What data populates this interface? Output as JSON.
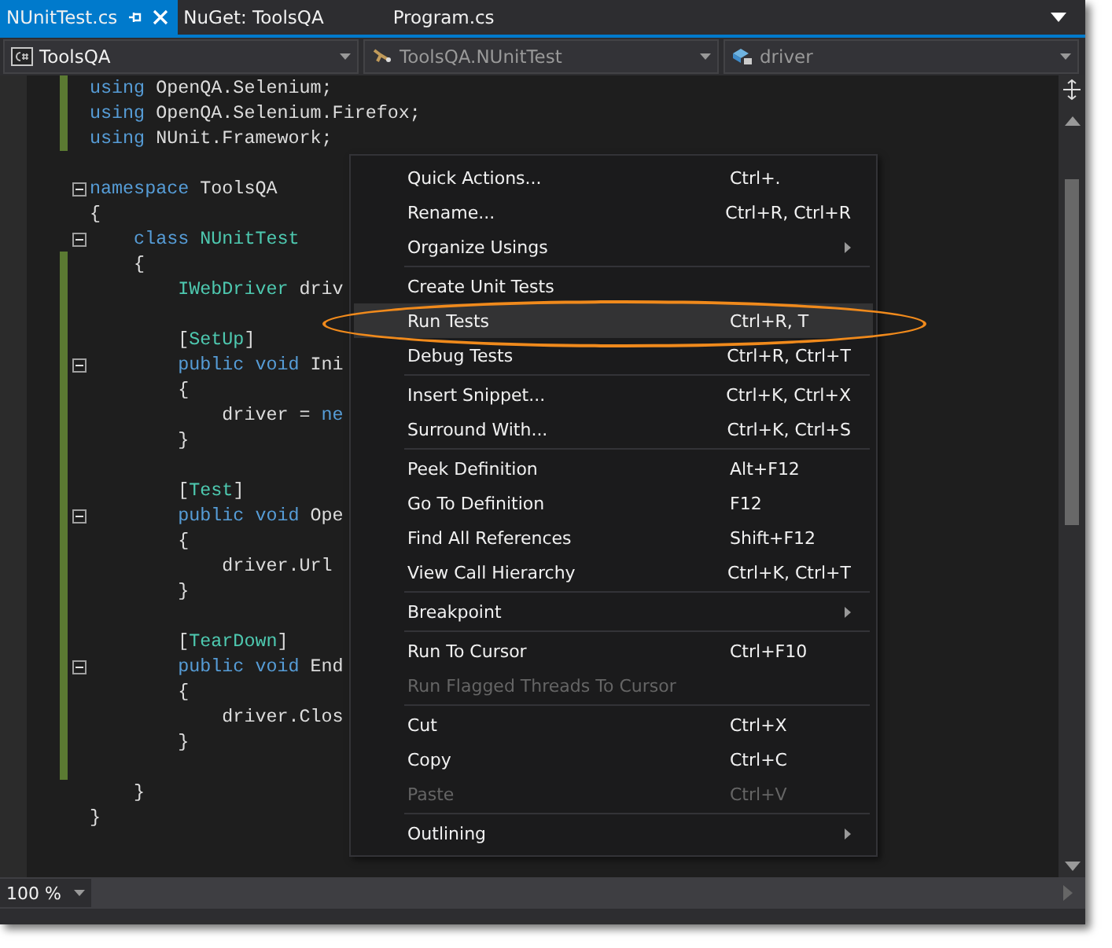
{
  "tabs": [
    {
      "label": "NUnitTest.cs",
      "selected": true,
      "pinned": true,
      "closable": true
    },
    {
      "label": "NuGet: ToolsQA",
      "selected": false,
      "pinned": false,
      "closable": false
    },
    {
      "label": "Program.cs",
      "selected": false,
      "pinned": false,
      "closable": false
    }
  ],
  "navigation": [
    {
      "text": "ToolsQA",
      "kind": "project",
      "dimmed": false
    },
    {
      "text": "ToolsQA.NUnitTest",
      "kind": "class",
      "dimmed": true
    },
    {
      "text": "driver",
      "kind": "field",
      "dimmed": true
    }
  ],
  "code_lines": [
    {
      "kind": "code",
      "fold": false,
      "changed": true,
      "tokens": [
        {
          "text": "using",
          "kind": "keyword"
        },
        {
          "text": " OpenQA.Selenium;",
          "kind": "plain"
        }
      ]
    },
    {
      "kind": "code",
      "fold": false,
      "changed": true,
      "tokens": [
        {
          "text": "using",
          "kind": "keyword"
        },
        {
          "text": " OpenQA.Selenium.Firefox;",
          "kind": "plain"
        }
      ]
    },
    {
      "kind": "code",
      "fold": false,
      "changed": true,
      "tokens": [
        {
          "text": "using",
          "kind": "keyword"
        },
        {
          "text": " NUnit.Framework;",
          "kind": "plain"
        }
      ]
    },
    {
      "kind": "blank"
    },
    {
      "kind": "code",
      "fold": true,
      "changed": false,
      "tokens": [
        {
          "text": "namespace",
          "kind": "keyword"
        },
        {
          "text": " ToolsQA",
          "kind": "plain"
        }
      ]
    },
    {
      "kind": "code",
      "fold": false,
      "changed": false,
      "tokens": [
        {
          "text": "{",
          "kind": "plain"
        }
      ]
    },
    {
      "kind": "code",
      "fold": true,
      "changed": false,
      "tokens": [
        {
          "text": "    class",
          "kind": "keyword"
        },
        {
          "text": " NUnitTest",
          "kind": "type"
        }
      ]
    },
    {
      "kind": "code",
      "fold": false,
      "changed": true,
      "tokens": [
        {
          "text": "    {",
          "kind": "plain"
        }
      ]
    },
    {
      "kind": "code",
      "fold": false,
      "changed": true,
      "tokens": [
        {
          "text": "        IWebDriver",
          "kind": "type"
        },
        {
          "text": " driv",
          "kind": "plain"
        }
      ]
    },
    {
      "kind": "blank",
      "changed": true
    },
    {
      "kind": "code",
      "fold": false,
      "changed": true,
      "tokens": [
        {
          "text": "        [",
          "kind": "plain"
        },
        {
          "text": "SetUp",
          "kind": "type"
        },
        {
          "text": "]",
          "kind": "plain"
        }
      ]
    },
    {
      "kind": "code",
      "fold": true,
      "changed": true,
      "tokens": [
        {
          "text": "        public void",
          "kind": "keyword"
        },
        {
          "text": " Ini",
          "kind": "plain"
        }
      ]
    },
    {
      "kind": "code",
      "fold": false,
      "changed": true,
      "tokens": [
        {
          "text": "        {",
          "kind": "plain"
        }
      ]
    },
    {
      "kind": "code",
      "fold": false,
      "changed": true,
      "tokens": [
        {
          "text": "            driver = ",
          "kind": "plain"
        },
        {
          "text": "ne",
          "kind": "keyword"
        }
      ]
    },
    {
      "kind": "code",
      "fold": false,
      "changed": true,
      "tokens": [
        {
          "text": "        }",
          "kind": "plain"
        }
      ]
    },
    {
      "kind": "blank",
      "changed": true
    },
    {
      "kind": "code",
      "fold": false,
      "changed": true,
      "tokens": [
        {
          "text": "        [",
          "kind": "plain"
        },
        {
          "text": "Test",
          "kind": "type"
        },
        {
          "text": "]",
          "kind": "plain"
        }
      ]
    },
    {
      "kind": "code",
      "fold": true,
      "changed": true,
      "tokens": [
        {
          "text": "        public void",
          "kind": "keyword"
        },
        {
          "text": " Ope",
          "kind": "plain"
        }
      ]
    },
    {
      "kind": "code",
      "fold": false,
      "changed": true,
      "tokens": [
        {
          "text": "        {",
          "kind": "plain"
        }
      ]
    },
    {
      "kind": "code",
      "fold": false,
      "changed": true,
      "tokens": [
        {
          "text": "            driver.Url",
          "kind": "plain"
        }
      ]
    },
    {
      "kind": "code",
      "fold": false,
      "changed": true,
      "tokens": [
        {
          "text": "        }",
          "kind": "plain"
        }
      ]
    },
    {
      "kind": "blank",
      "changed": true
    },
    {
      "kind": "code",
      "fold": false,
      "changed": true,
      "tokens": [
        {
          "text": "        [",
          "kind": "plain"
        },
        {
          "text": "TearDown",
          "kind": "type"
        },
        {
          "text": "]",
          "kind": "plain"
        }
      ]
    },
    {
      "kind": "code",
      "fold": true,
      "changed": true,
      "tokens": [
        {
          "text": "        public void",
          "kind": "keyword"
        },
        {
          "text": " End",
          "kind": "plain"
        }
      ]
    },
    {
      "kind": "code",
      "fold": false,
      "changed": true,
      "tokens": [
        {
          "text": "        {",
          "kind": "plain"
        }
      ]
    },
    {
      "kind": "code",
      "fold": false,
      "changed": true,
      "tokens": [
        {
          "text": "            driver.Clos",
          "kind": "plain"
        }
      ]
    },
    {
      "kind": "code",
      "fold": false,
      "changed": true,
      "tokens": [
        {
          "text": "        }",
          "kind": "plain"
        }
      ]
    },
    {
      "kind": "blank",
      "changed": true
    },
    {
      "kind": "code",
      "fold": false,
      "changed": false,
      "tokens": [
        {
          "text": "    }",
          "kind": "plain"
        }
      ]
    },
    {
      "kind": "code",
      "fold": false,
      "changed": false,
      "tokens": [
        {
          "text": "}",
          "kind": "plain"
        }
      ]
    }
  ],
  "context_menu": {
    "items": [
      {
        "kind": "command",
        "label": "Quick Actions...",
        "shortcut": "Ctrl+.",
        "disabled": false,
        "submenu": false,
        "selected": false,
        "circled": false
      },
      {
        "kind": "command",
        "label": "Rename...",
        "shortcut": "Ctrl+R, Ctrl+R",
        "disabled": false,
        "submenu": false,
        "selected": false,
        "circled": false
      },
      {
        "kind": "command",
        "label": "Organize Usings",
        "disabled": false,
        "submenu": true,
        "selected": false,
        "circled": false
      },
      {
        "kind": "separator"
      },
      {
        "kind": "command",
        "label": "Create Unit Tests",
        "disabled": false,
        "submenu": false,
        "selected": false,
        "circled": false
      },
      {
        "kind": "command",
        "label": "Run Tests",
        "shortcut": "Ctrl+R, T",
        "disabled": false,
        "submenu": false,
        "selected": true,
        "circled": true
      },
      {
        "kind": "command",
        "label": "Debug Tests",
        "shortcut": "Ctrl+R, Ctrl+T",
        "disabled": false,
        "submenu": false,
        "selected": false,
        "circled": false
      },
      {
        "kind": "separator"
      },
      {
        "kind": "command",
        "label": "Insert Snippet...",
        "shortcut": "Ctrl+K, Ctrl+X",
        "disabled": false,
        "submenu": false,
        "selected": false,
        "circled": false
      },
      {
        "kind": "command",
        "label": "Surround With...",
        "shortcut": "Ctrl+K, Ctrl+S",
        "disabled": false,
        "submenu": false,
        "selected": false,
        "circled": false
      },
      {
        "kind": "separator"
      },
      {
        "kind": "command",
        "label": "Peek Definition",
        "shortcut": "Alt+F12",
        "disabled": false,
        "submenu": false,
        "selected": false,
        "circled": false
      },
      {
        "kind": "command",
        "label": "Go To Definition",
        "shortcut": "F12",
        "disabled": false,
        "submenu": false,
        "selected": false,
        "circled": false
      },
      {
        "kind": "command",
        "label": "Find All References",
        "shortcut": "Shift+F12",
        "disabled": false,
        "submenu": false,
        "selected": false,
        "circled": false
      },
      {
        "kind": "command",
        "label": "View Call Hierarchy",
        "shortcut": "Ctrl+K, Ctrl+T",
        "disabled": false,
        "submenu": false,
        "selected": false,
        "circled": false
      },
      {
        "kind": "separator"
      },
      {
        "kind": "command",
        "label": "Breakpoint",
        "disabled": false,
        "submenu": true,
        "selected": false,
        "circled": false
      },
      {
        "kind": "separator"
      },
      {
        "kind": "command",
        "label": "Run To Cursor",
        "shortcut": "Ctrl+F10",
        "disabled": false,
        "submenu": false,
        "selected": false,
        "circled": false
      },
      {
        "kind": "command",
        "label": "Run Flagged Threads To Cursor",
        "disabled": true,
        "submenu": false,
        "selected": false,
        "circled": false
      },
      {
        "kind": "separator"
      },
      {
        "kind": "command",
        "label": "Cut",
        "shortcut": "Ctrl+X",
        "disabled": false,
        "submenu": false,
        "selected": false,
        "circled": false
      },
      {
        "kind": "command",
        "label": "Copy",
        "shortcut": "Ctrl+C",
        "disabled": false,
        "submenu": false,
        "selected": false,
        "circled": false
      },
      {
        "kind": "command",
        "label": "Paste",
        "shortcut": "Ctrl+V",
        "disabled": true,
        "submenu": false,
        "selected": false,
        "circled": false
      },
      {
        "kind": "separator"
      },
      {
        "kind": "command",
        "label": "Outlining",
        "disabled": false,
        "submenu": true,
        "selected": false,
        "circled": false
      }
    ]
  },
  "zoom": "100 %"
}
